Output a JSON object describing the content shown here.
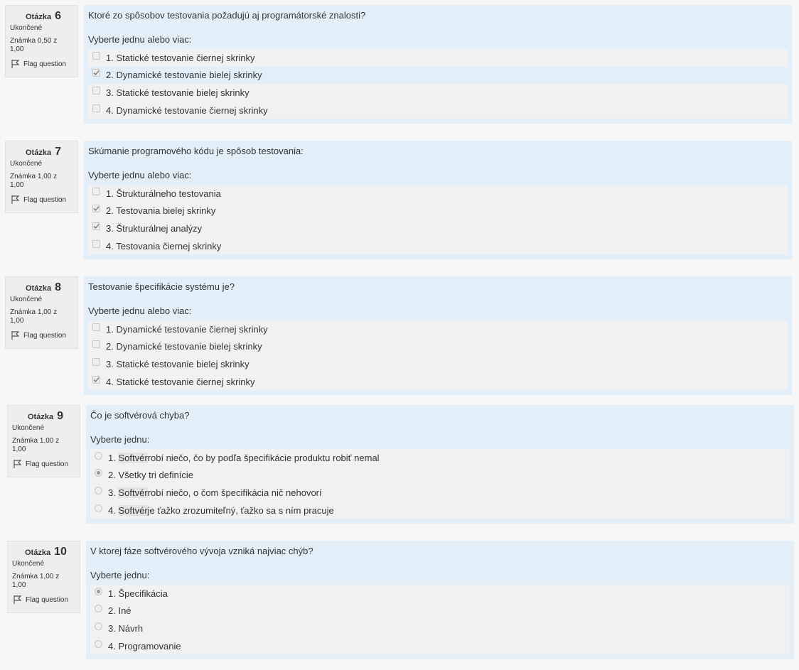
{
  "labels": {
    "otazka": "Otázka",
    "flag": "Flag question"
  },
  "questions": [
    {
      "number": "6",
      "state": "Ukončené",
      "grade": "Známka 0,50 z 1,00",
      "text": "Ktoré zo spôsobov testovania požadujú aj programátorské znalosti?",
      "prompt": "Vyberte jednu alebo viac:",
      "type": "checkbox",
      "answers": [
        {
          "label": "1. Statické testovanie čiernej skrinky",
          "checked": false
        },
        {
          "label": "2. Dynamické testovanie bielej skrinky",
          "checked": true
        },
        {
          "label": "3. Statické testovanie bielej skrinky",
          "checked": false
        },
        {
          "label": "4. Dynamické testovanie čiernej skrinky",
          "checked": false
        }
      ]
    },
    {
      "number": "7",
      "state": "Ukončené",
      "grade": "Známka 1,00 z 1,00",
      "text": "Skúmanie programového kódu je spôsob testovania:",
      "prompt": "Vyberte jednu alebo viac:",
      "type": "checkbox",
      "answers": [
        {
          "label": "1. Štrukturálneho testovania",
          "checked": false
        },
        {
          "label": "2. Testovania bielej skrinky",
          "checked": true
        },
        {
          "label": "3. Štrukturálnej analýzy",
          "checked": true
        },
        {
          "label": "4. Testovania čiernej skrinky",
          "checked": false
        }
      ]
    },
    {
      "number": "8",
      "state": "Ukončené",
      "grade": "Známka 1,00 z 1,00",
      "text": "Testovanie špecifikácie systému je?",
      "prompt": "Vyberte jednu alebo viac:",
      "type": "checkbox",
      "answers": [
        {
          "label": "1. Dynamické testovanie čiernej skrinky",
          "checked": false
        },
        {
          "label": "2. Dynamické testovanie bielej skrinky",
          "checked": false
        },
        {
          "label": "3. Statické testovanie bielej skrinky",
          "checked": false
        },
        {
          "label": "4. Statické testovanie čiernej skrinky",
          "checked": true
        }
      ]
    },
    {
      "number": "9",
      "state": "Ukončené",
      "grade": "Známka 1,00 z 1,00",
      "text": "Čo je softvérová chyba?",
      "prompt": "Vyberte jednu:",
      "type": "radio",
      "answers": [
        {
          "num": "1.",
          "hl": "Softvér",
          "rest": " robí niečo, čo by podľa špecifikácie produktu robiť nemal",
          "checked": false
        },
        {
          "num": "2.",
          "hl": "",
          "rest": "Všetky tri definície",
          "checked": true
        },
        {
          "num": "3.",
          "hl": "Softvér",
          "rest": " robí niečo, o čom špecifikácia nič nehovorí",
          "checked": false
        },
        {
          "num": "4.",
          "hl": "Softvér",
          "rest": " je ťažko zrozumiteľný, ťažko sa s ním pracuje",
          "checked": false
        }
      ]
    },
    {
      "number": "10",
      "state": "Ukončené",
      "grade": "Známka 1,00 z 1,00",
      "text": "V ktorej fáze softvérového vývoja vzniká najviac chýb?",
      "prompt": "Vyberte jednu:",
      "type": "radio",
      "answers": [
        {
          "label": "1. Špecifikácia",
          "checked": true
        },
        {
          "label": "2. Iné",
          "checked": false
        },
        {
          "label": "3. Návrh",
          "checked": false
        },
        {
          "label": "4. Programovanie",
          "checked": false
        }
      ]
    }
  ]
}
